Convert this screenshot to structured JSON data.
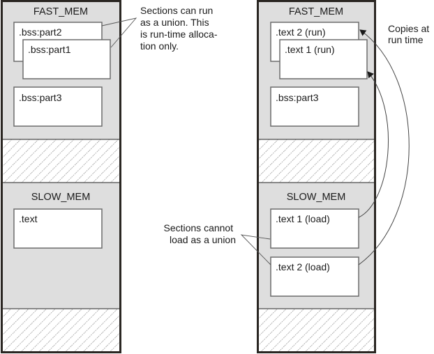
{
  "colors": {
    "memory_fill": "#dedede",
    "section_fill": "#ffffff",
    "border": "#2a2622",
    "hatch": "#8a8a8a"
  },
  "left_map": {
    "fast_mem": {
      "title": "FAST_MEM",
      "sections": [
        ".bss:part2",
        ".bss:part1",
        ".bss:part3"
      ]
    },
    "slow_mem": {
      "title": "SLOW_MEM",
      "sections": [
        ".text"
      ]
    }
  },
  "right_map": {
    "fast_mem": {
      "title": "FAST_MEM",
      "sections": [
        ".text 2 (run)",
        ".text 1 (run)",
        ".bss:part3"
      ]
    },
    "slow_mem": {
      "title": "SLOW_MEM",
      "sections": [
        ".text 1 (load)",
        ".text 2 (load)"
      ]
    }
  },
  "annotations": {
    "union_note": [
      "Sections can run",
      "as a union. This",
      "is run-time alloca-",
      "tion only."
    ],
    "copy_note": [
      "Copies at",
      "run time"
    ],
    "no_union_note": [
      "Sections cannot",
      "load as a union"
    ]
  }
}
